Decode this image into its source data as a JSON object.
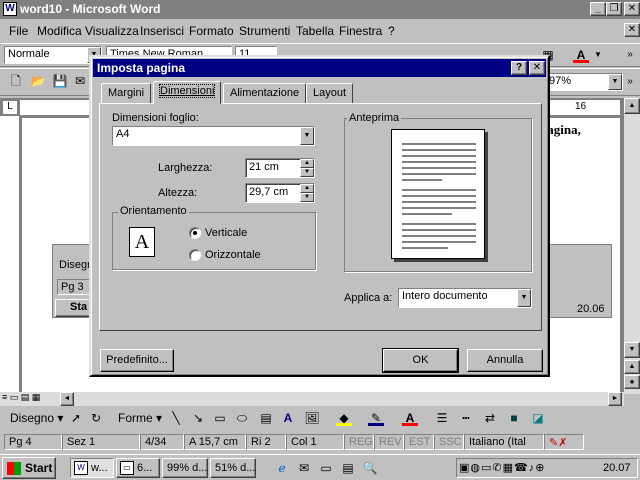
{
  "window": {
    "title": "word10 - Microsoft Word"
  },
  "menu": [
    "File",
    "Modifica",
    "Visualizza",
    "Inserisci",
    "Formato",
    "Strumenti",
    "Tabella",
    "Finestra",
    "?"
  ],
  "toolbar": {
    "style_value": "Normale",
    "font_value": "Times New Roman",
    "size_value": "11",
    "zoom_value": "97%"
  },
  "document": {
    "text_fragment": "pagina,",
    "ruler_mark": "16"
  },
  "dialog": {
    "title": "Imposta pagina",
    "tabs": [
      "Margini",
      "Dimensioni",
      "Alimentazione",
      "Layout"
    ],
    "active_tab": "Dimensioni",
    "paper_size_label": "Dimensioni foglio:",
    "paper_size_value": "A4",
    "width_label": "Larghezza:",
    "width_value": "21 cm",
    "height_label": "Altezza:",
    "height_value": "29,7 cm",
    "orientation_label": "Orientamento",
    "orientation_glyph": "A",
    "orientation_options": [
      "Verticale",
      "Orizzontale"
    ],
    "orientation_selected": "Verticale",
    "preview_label": "Anteprima",
    "apply_label": "Applica a:",
    "apply_value": "Intero documento",
    "buttons": {
      "default": "Predefinito...",
      "ok": "OK",
      "cancel": "Annulla"
    }
  },
  "background_panel": {
    "tab1": "Disegn",
    "page_label": "Pg 3",
    "start": "Sta",
    "clock": "20.06"
  },
  "drawbar": {
    "draw_label": "Disegno",
    "shapes_label": "Forme"
  },
  "status": {
    "page": "Pg 4",
    "section": "Sez 1",
    "pages": "4/34",
    "position": "A 15,7 cm",
    "line": "Ri 2",
    "column": "Col 1",
    "modes": [
      "REG",
      "REV",
      "EST",
      "SSC"
    ],
    "language": "Italiano (Ital"
  },
  "taskbar": {
    "start": "Start",
    "tasks": [
      "w...",
      "6...",
      "99% d...",
      "51% d..."
    ],
    "clock": "20.07"
  }
}
